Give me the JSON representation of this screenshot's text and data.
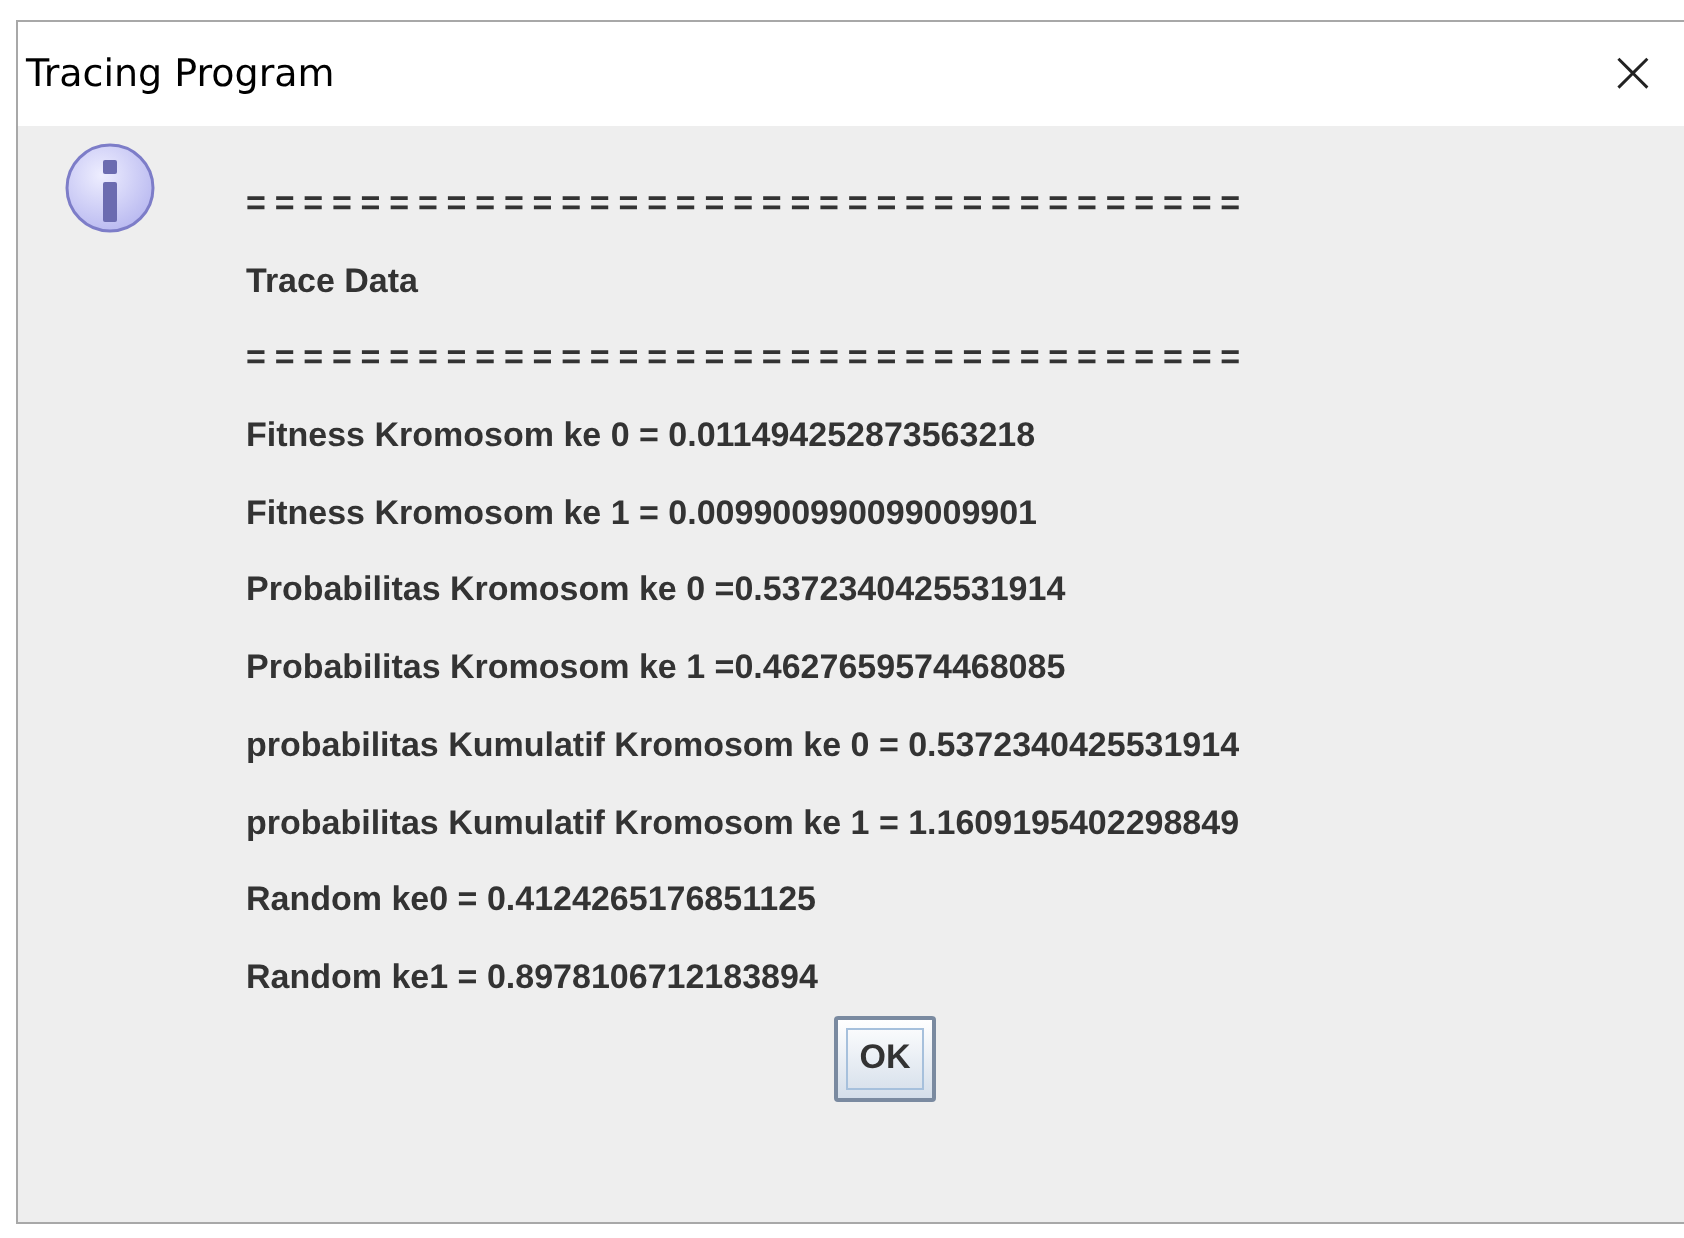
{
  "window": {
    "title": "Tracing Program",
    "close": "×"
  },
  "message_lines": [
    {
      "kind": "separator",
      "text": "==================================="
    },
    {
      "kind": "text",
      "text": "Trace Data"
    },
    {
      "kind": "separator",
      "text": "==================================="
    },
    {
      "kind": "text",
      "text": "Fitness Kromosom ke 0 = 0.011494252873563218"
    },
    {
      "kind": "text",
      "text": "Fitness Kromosom ke 1 = 0.009900990099009901"
    },
    {
      "kind": "text",
      "text": "Probabilitas Kromosom ke 0 =0.5372340425531914"
    },
    {
      "kind": "text",
      "text": "Probabilitas Kromosom ke 1 =0.4627659574468085"
    },
    {
      "kind": "text",
      "text": "probabilitas Kumulatif Kromosom ke 0 = 0.5372340425531914"
    },
    {
      "kind": "text",
      "text": "probabilitas Kumulatif Kromosom ke 1 = 1.1609195402298849"
    },
    {
      "kind": "text",
      "text": "Random ke0 = 0.4124265176851125"
    },
    {
      "kind": "text",
      "text": "Random ke1 = 0.8978106712183894"
    }
  ],
  "buttons": [
    {
      "label": "OK"
    }
  ]
}
